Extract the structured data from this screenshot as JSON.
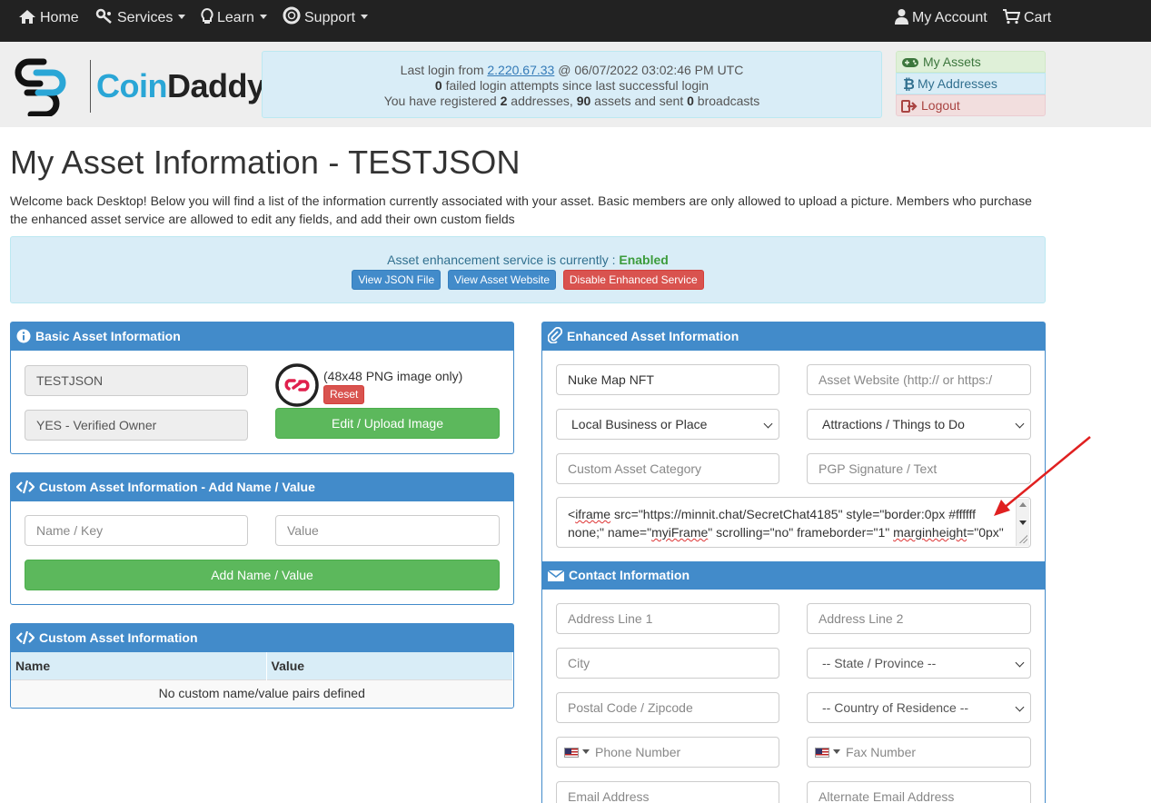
{
  "nav": {
    "home": "Home",
    "services": "Services",
    "learn": "Learn",
    "support": "Support",
    "account": "My Account",
    "cart": "Cart"
  },
  "logo": {
    "part1": "Coin",
    "part2": "Daddy"
  },
  "login": {
    "prefix": "Last login from ",
    "ip": "2.220.67.33",
    "suffix": " @ 06/07/2022 03:02:46 PM UTC",
    "failed_count": "0",
    "failed_text": " failed login attempts since last successful login",
    "reg_prefix": "You have registered ",
    "addresses": "2",
    "mid1": " addresses, ",
    "assets": "90",
    "mid2": " assets and sent ",
    "broadcasts": "0",
    "mid3": " broadcasts"
  },
  "account_menu": {
    "assets": "My Assets",
    "addresses": "My Addresses",
    "logout": "Logout"
  },
  "page": {
    "title": "My Asset Information - TESTJSON",
    "intro": "Welcome back Desktop! Below you will find a list of the information currently associated with your asset. Basic members are only allowed to upload a picture. Members who purchase the enhanced asset service are allowed to edit any fields, and add their own custom fields"
  },
  "service": {
    "label": "Asset enhancement service is currently : ",
    "status": "Enabled",
    "view_json": "View JSON File",
    "view_site": "View Asset Website",
    "disable": "Disable Enhanced Service"
  },
  "basic": {
    "heading": "Basic Asset Information",
    "asset_name": "TESTJSON",
    "owner": "YES - Verified Owner",
    "image_note": "(48x48 PNG image only)",
    "reset": "Reset",
    "upload": "Edit / Upload Image"
  },
  "custom_add": {
    "heading": "Custom Asset Information - Add Name / Value",
    "name_placeholder": "Name / Key",
    "value_placeholder": "Value",
    "add_button": "Add Name / Value"
  },
  "custom_list": {
    "heading": "Custom Asset Information",
    "col_name": "Name",
    "col_value": "Value",
    "empty": "No custom name/value pairs defined"
  },
  "enhanced": {
    "heading": "Enhanced Asset Information",
    "name": "Nuke Map NFT",
    "website_placeholder": "Asset Website (http:// or https:/",
    "category": "Local Business or Place",
    "subcategory": "Attractions / Things to Do",
    "custom_category_placeholder": "Custom Asset Category",
    "pgp_placeholder": "PGP Signature / Text",
    "description_line1_a": "iframe",
    "description_line1_b": " src=\"https://minnit.chat/SecretChat4185\" style=\"border:0px #ffffff",
    "description_line2_a": "none;\" name=\"",
    "description_line2_b": "myiFrame",
    "description_line2_c": "\" scrolling=\"no\" frameborder=\"1\" ",
    "description_line2_d": "marginheight",
    "description_line2_e": "=\"0px\""
  },
  "contact": {
    "heading": "Contact Information",
    "address1": "Address Line 1",
    "address2": "Address Line 2",
    "city": "City",
    "state": "-- State / Province --",
    "postal": "Postal Code / Zipcode",
    "country": "-- Country of Residence --",
    "phone": "Phone Number",
    "fax": "Fax Number",
    "email": "Email Address",
    "alt_email": "Alternate Email Address"
  },
  "colors": {
    "primary": "#428bca",
    "success": "#5cb85c",
    "danger": "#d9534f",
    "nav_bg": "#222222",
    "annotation_arrow": "#e02020"
  }
}
